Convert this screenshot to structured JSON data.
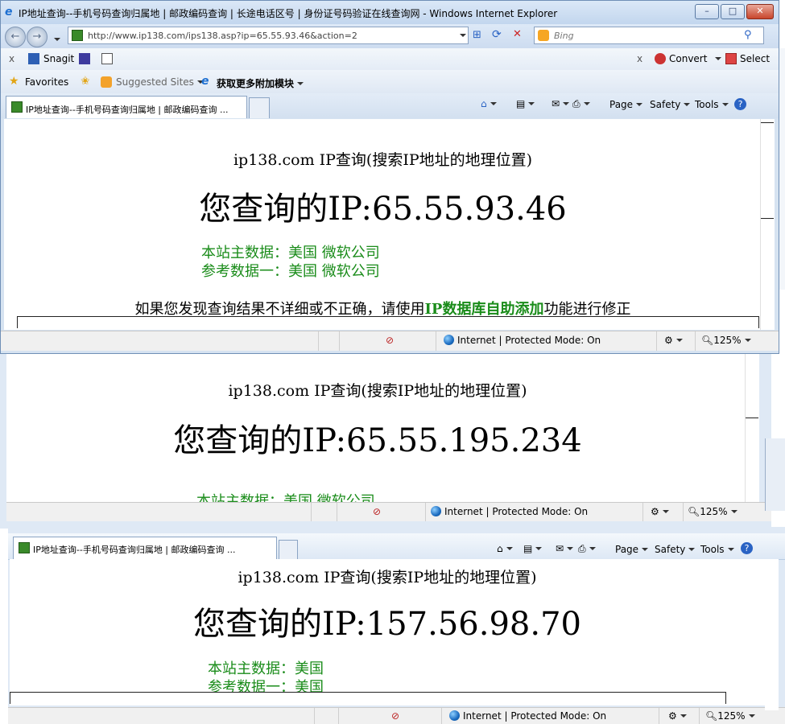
{
  "window": {
    "title": "IP地址查询--手机号码查询归属地 | 邮政编码查询 | 长途电话区号 | 身份证号码验证在线查询网 - Windows Internet Explorer",
    "min": "–",
    "max": "□",
    "close": "✕"
  },
  "address": {
    "url": "http://www.ip138.com/ips138.asp?ip=65.55.93.46&action=2"
  },
  "search": {
    "placeholder": "Bing"
  },
  "snagit": {
    "label": "Snagit",
    "convert": "Convert",
    "select": "Select",
    "close": "x"
  },
  "favorites": {
    "favorites_label": "Favorites",
    "suggested_label": "Suggested Sites",
    "addons_label": "获取更多附加模块"
  },
  "tab": {
    "title": "IP地址查询--手机号码查询归属地 | 邮政编码查询 ..."
  },
  "cmdbar": {
    "page": "Page",
    "safety": "Safety",
    "tools": "Tools",
    "help": "?"
  },
  "status": {
    "zone": "Internet | Protected Mode: On",
    "zoom": "125%"
  },
  "pages": [
    {
      "heading": "ip138.com IP查询(搜索IP地址的地理位置)",
      "ip_line": "您查询的IP:65.55.93.46",
      "data1": "本站主数据：美国 微软公司",
      "data2": "参考数据一：美国 微软公司",
      "note_prefix": "如果您发现查询结果不详细或不正确，请使用",
      "note_link": "IP数据库自助添加",
      "note_suffix": "功能进行修正"
    },
    {
      "heading": "ip138.com IP查询(搜索IP地址的地理位置)",
      "ip_line": "您查询的IP:65.55.195.234",
      "data1": "本站主数据：美国 微软公司"
    },
    {
      "heading": "ip138.com IP查询(搜索IP地址的地理位置)",
      "ip_line": "您查询的IP:157.56.98.70",
      "data1": "本站主数据：美国",
      "data2": "参考数据一：美国"
    }
  ],
  "colors": {
    "green_text": "#1a8c1a",
    "frame_blue": "#d6e3f1"
  }
}
